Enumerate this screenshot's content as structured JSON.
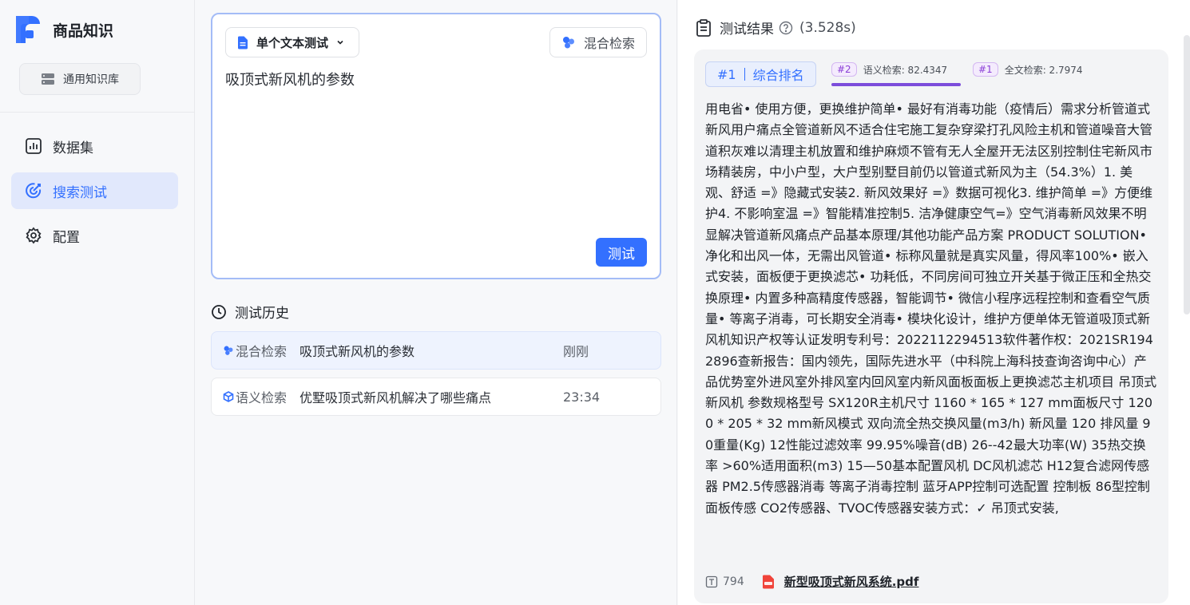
{
  "app": {
    "title": "商品知识",
    "knowledge_base_label": "通用知识库"
  },
  "nav": {
    "items": [
      {
        "label": "数据集",
        "icon": "bar-chart-icon"
      },
      {
        "label": "搜索测试",
        "icon": "target-icon",
        "active": true
      },
      {
        "label": "配置",
        "icon": "gear-icon"
      }
    ]
  },
  "query": {
    "mode_label": "单个文本测试",
    "search_mode_label": "混合检索",
    "text": "吸顶式新风机的参数",
    "test_button": "测试"
  },
  "history": {
    "title": "测试历史",
    "items": [
      {
        "type": "混合检索",
        "query": "吸顶式新风机的参数",
        "time": "刚刚"
      },
      {
        "type": "语义检索",
        "query": "优墅吸顶式新风机解决了哪些痛点",
        "time": "23:34"
      }
    ]
  },
  "results": {
    "title": "测试结果",
    "elapsed": "(3.528s)",
    "items": [
      {
        "rank_label": "#1",
        "rank_desc": "综合排名",
        "semantic_tag": "#2",
        "semantic_score": "语义检索: 82.4347",
        "fulltext_tag": "#1",
        "fulltext_score": "全文检索: 2.7974",
        "content": "用电省• 使用方便，更换维护简单• 最好有消毒功能（疫情后）需求分析管道式新风用户痛点全管道新风不适合住宅施工复杂穿梁打孔风险主机和管道噪音大管道积灰难以清理主机放置和维护麻烦不管有无人全屋开无法区别控制住宅新风市场精装房，中小户型，大户型别墅目前仍以管道式新风为主（54.3%）1. 美观、舒适 =》隐藏式安装2. 新风效果好 =》数据可视化3. 维护简单 =》方便维护4. 不影响室温 =》智能精准控制5. 洁净健康空气=》空气消毒新风效果不明显解决管道新风痛点产品基本原理/其他功能产品方案 PRODUCT SOLUTION• 净化和出风一体，无需出风管道• 标称风量就是真实风量，得风率100%• 嵌入式安装，面板便于更换滤芯• 功耗低，不同房间可独立开关基于微正压和全热交换原理• 内置多种高精度传感器，智能调节• 微信小程序远程控制和查看空气质量• 等离子消毒，可长期安全消毒• 模块化设计，维护方便单体无管道吸顶式新风机知识产权等认证发明专利号：2022112294513软件著作权：2021SR1942896查新报告：国内领先，国际先进水平（中科院上海科技查询咨询中心）产品优势室外进风室外排风室内回风室内新风面板面板上更换滤芯主机项目 吊顶式新风机 参数规格型号 SX120R主机尺寸 1160 * 165 * 127 mm面板尺寸 1200 * 205 * 32 mm新风模式 双向流全热交换风量(m3/h) 新风量 120 排风量 90重量(Kg) 12性能过滤效率 99.95%噪音(dB) 26--42最大功率(W) 35热交换率 >60%适用面积(m3) 15—50基本配置风机 DC风机滤芯 H12复合滤网传感器 PM2.5传感器消毒 等离子消毒控制 蓝牙APP控制可选配置 控制板 86型控制面板传感 CO2传感器、TVOC传感器安装方式：✓ 吊顶式安装,",
        "char_count": "794",
        "file_name": "新型吸顶式新风系统.pdf"
      }
    ]
  },
  "colors": {
    "accent": "#3370ff",
    "semantic_tag": "#8a3ed6",
    "file_icon": "#f0433a"
  }
}
